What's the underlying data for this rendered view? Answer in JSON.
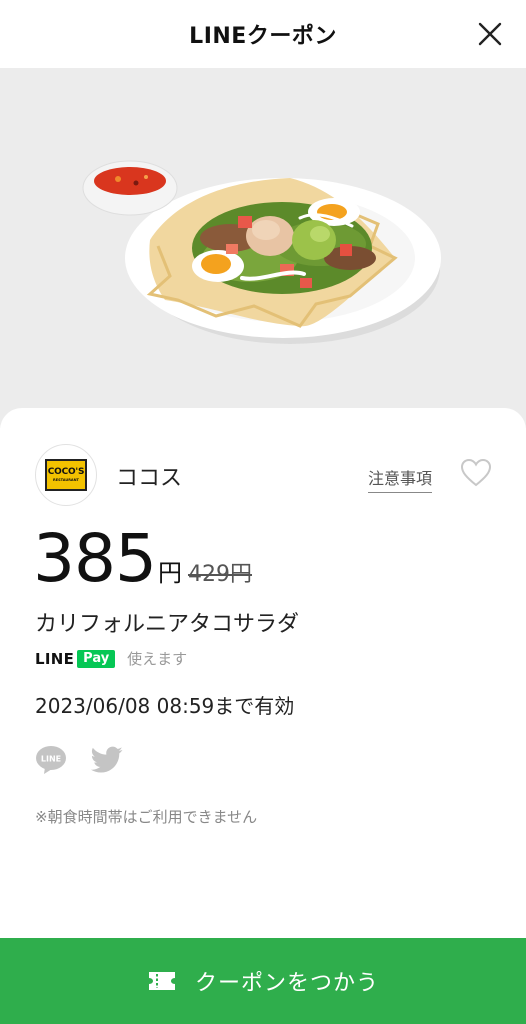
{
  "header": {
    "title": "LINEクーポン",
    "close_icon": "close-icon"
  },
  "hero": {
    "image": "taco-salad-photo",
    "background": "#ececec"
  },
  "store": {
    "logo_text": "COCO'S",
    "logo_subtext": "RESTAURANT",
    "name": "ココス",
    "notice_label": "注意事項",
    "favorite_icon": "heart-outline-icon"
  },
  "coupon": {
    "price": "385",
    "price_unit": "円",
    "original_price": "429円",
    "product_name": "カリフォルニアタコサラダ",
    "payment": {
      "brand_line": "LINE",
      "brand_pay": "Pay",
      "text": "使えます"
    },
    "expiry": "2023/06/08  08:59まで有効",
    "note": "※朝食時間帯はご利用できません"
  },
  "share": {
    "line_icon": "line-share-icon",
    "line_text": "LINE",
    "twitter_icon": "twitter-icon"
  },
  "action": {
    "use_label": "クーポンをつかう",
    "icon": "ticket-icon",
    "color": "#2fae4c"
  }
}
